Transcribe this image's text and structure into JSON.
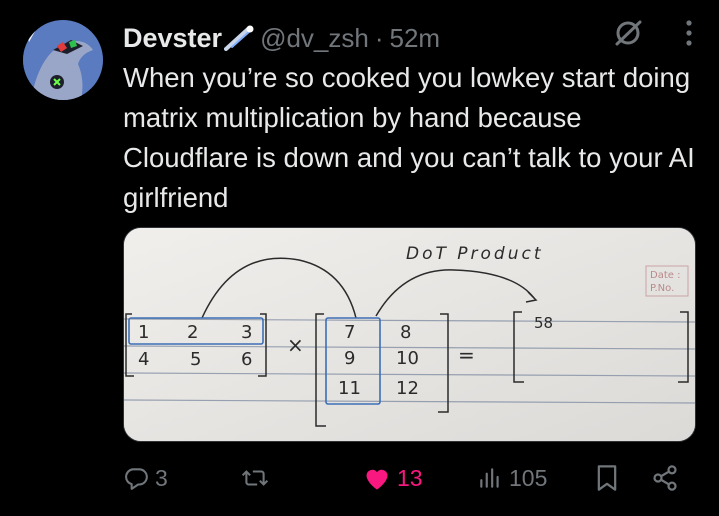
{
  "tweet": {
    "author_name": "Devster",
    "handle": "@dv_zsh",
    "separator": "·",
    "time": "52m",
    "text": "When you’re so cooked you lowkey start doing matrix multiplication by hand because Cloudflare is down and you can’t talk to your AI girlfriend"
  },
  "media": {
    "annotation": "DoT Product",
    "stamp_date": "Date :",
    "stamp_page": "P.No.",
    "matrix_a": [
      [
        "1",
        "2",
        "3"
      ],
      [
        "4",
        "5",
        "6"
      ]
    ],
    "matrix_b": [
      [
        "7",
        "8"
      ],
      [
        "9",
        "10"
      ],
      [
        "11",
        "12"
      ]
    ],
    "times_sign": "×",
    "equals_sign": "=",
    "result": "58"
  },
  "actions": {
    "replies": "3",
    "reposts": "",
    "likes": "13",
    "views": "105"
  },
  "colors": {
    "background": "#000000",
    "text": "#e7e9ea",
    "muted": "#71767b",
    "like": "#f91880"
  },
  "icons": [
    "verified-meteor-icon",
    "grok-icon",
    "more-icon",
    "reply-icon",
    "repost-icon",
    "heart-icon",
    "views-icon",
    "bookmark-icon",
    "share-icon"
  ]
}
